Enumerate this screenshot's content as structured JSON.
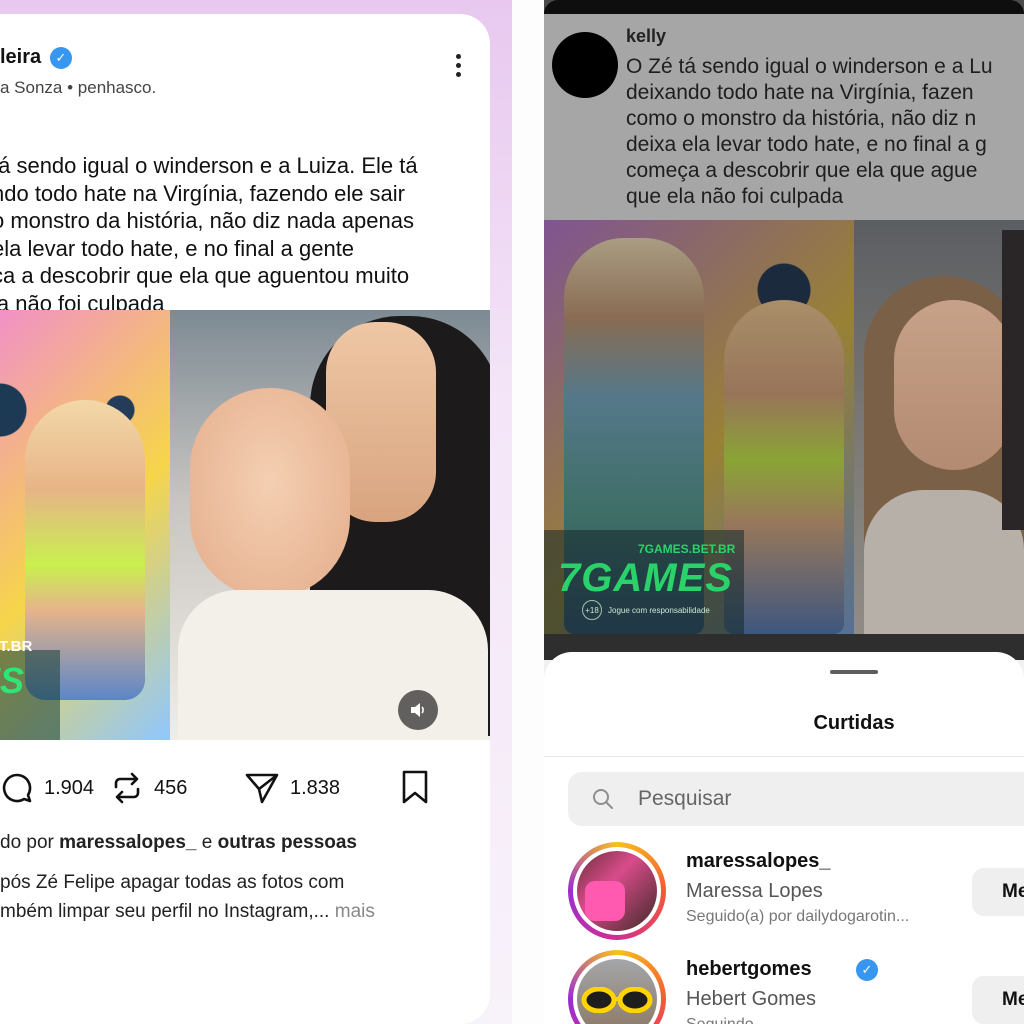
{
  "left_post": {
    "username": "leira",
    "subtitle": "a Sonza • penhasco.",
    "text": "tá sendo igual o winderson e a Luiza. Ele tá\nndo todo hate na Virgínia, fazendo ele sair\no monstro da história, não diz nada apenas\nela levar todo hate, e no final a gente\nça a descobrir que ela que aguentou muito\nla não foi culpada",
    "media_badge_site": ".BET.BR",
    "media_badge_logo": "ES",
    "actions": {
      "comments": "1.904",
      "reposts": "456",
      "shares": "1.838"
    },
    "liked_by_prefix": "do por ",
    "liked_by_user": "maressalopes_",
    "liked_by_mid": " e ",
    "liked_by_others": "outras pessoas",
    "caption": "pós Zé Felipe apagar todas as fotos com\nmbém limpar seu perfil no Instagram,...",
    "caption_more": " mais"
  },
  "right_post": {
    "username": "kelly",
    "text": "O Zé tá sendo igual o winderson e a Lu\ndeixando todo hate na Virgínia, fazen\ncomo o monstro da história, não diz n\ndeixa ela levar todo hate, e no final a g\ncomeça a descobrir que ela que ague\nque ela não foi culpada",
    "media_badge_site": "7GAMES.BET.BR",
    "media_badge_logo": "7GAMES",
    "media_badge_age": "+18",
    "media_badge_note": "Jogue com responsabilidade"
  },
  "likes_sheet": {
    "title": "Curtidas",
    "search_placeholder": "Pesquisar",
    "users": [
      {
        "username": "maressalopes_",
        "full_name": "Maressa Lopes",
        "note": "Seguido(a) por dailydogarotin...",
        "button": "Me"
      },
      {
        "username": "hebertgomes",
        "full_name": "Hebert Gomes",
        "note": "Seguindo",
        "verified": true,
        "button": "Me"
      }
    ]
  },
  "colors": {
    "verified_blue": "#3797f0",
    "story_ring": [
      "#f9c01c",
      "#f45a34",
      "#d22e8f",
      "#9b2ed2"
    ]
  }
}
